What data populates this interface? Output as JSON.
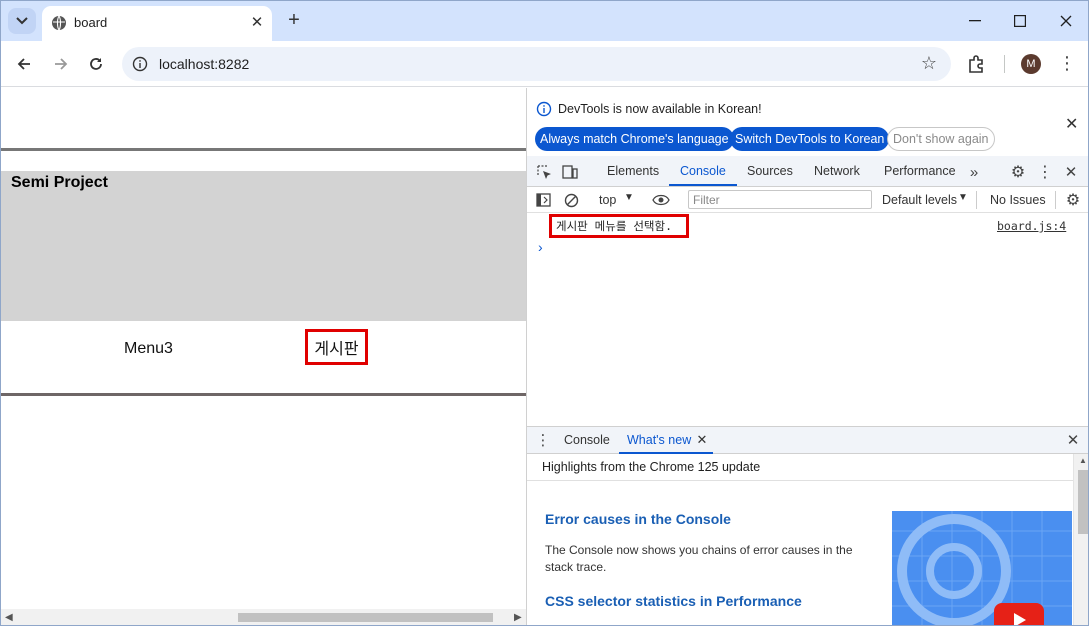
{
  "browser": {
    "tab_title": "board",
    "url": "localhost:8282",
    "avatar_letter": "M"
  },
  "page": {
    "project_title": "Semi Project",
    "menu": [
      "Menu3",
      "게시판"
    ]
  },
  "devtools": {
    "infobar": {
      "message": "DevTools is now available in Korean!",
      "btn_match": "Always match Chrome's language",
      "btn_switch": "Switch DevTools to Korean",
      "btn_dismiss": "Don't show again"
    },
    "tabs": [
      "Elements",
      "Console",
      "Sources",
      "Network",
      "Performance"
    ],
    "active_tab": "Console",
    "console_toolbar": {
      "context": "top",
      "filter_placeholder": "Filter",
      "levels": "Default levels",
      "issues": "No Issues"
    },
    "log": {
      "message": "게시판 메뉴를 선택함.",
      "source": "board.js:4"
    },
    "drawer": {
      "tabs": [
        "Console",
        "What's new"
      ],
      "active_tab": "What's new",
      "header": "Highlights from the Chrome 125 update",
      "items": [
        {
          "title": "Error causes in the Console",
          "description": "The Console now shows you chains of error causes in the stack trace."
        },
        {
          "title": "CSS selector statistics in Performance"
        }
      ]
    }
  },
  "colors": {
    "accent": "#0b57d0",
    "highlight_border": "#e00000",
    "banner": "#d3d3d3"
  }
}
